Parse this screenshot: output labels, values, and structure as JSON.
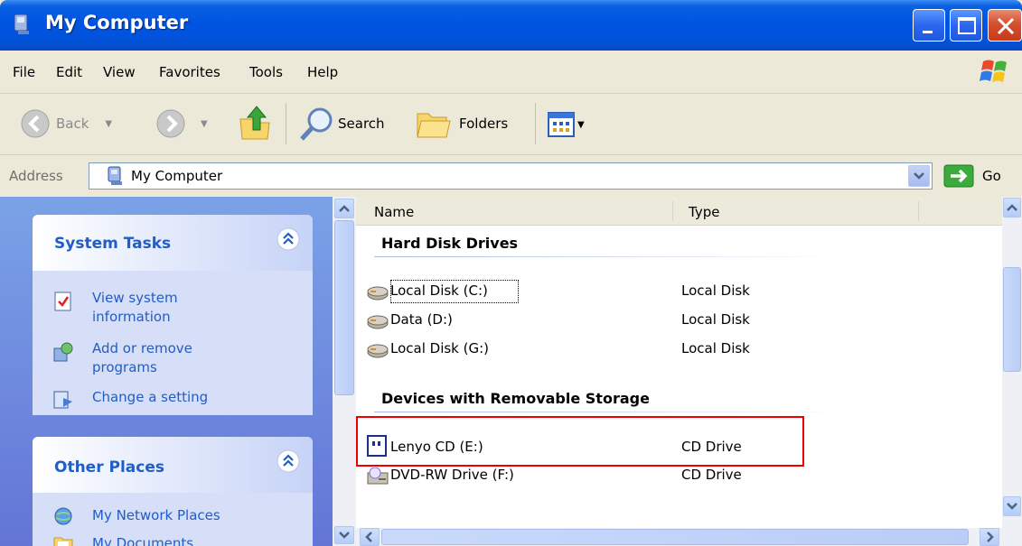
{
  "window": {
    "title": "My Computer"
  },
  "menu": [
    "File",
    "Edit",
    "View",
    "Favorites",
    "Tools",
    "Help"
  ],
  "toolbar": {
    "back_label": "Back",
    "search_label": "Search",
    "folders_label": "Folders"
  },
  "address": {
    "label": "Address",
    "value": "My Computer",
    "go_label": "Go"
  },
  "left_pane": {
    "system_tasks": {
      "title": "System Tasks",
      "items": [
        "View system information",
        "Add or remove programs",
        "Change a setting"
      ]
    },
    "other_places": {
      "title": "Other Places",
      "items": [
        "My Network Places",
        "My Documents"
      ]
    }
  },
  "list": {
    "columns": [
      "Name",
      "Type"
    ],
    "groups": [
      {
        "title": "Hard Disk Drives",
        "items": [
          {
            "name": "Local Disk (C:)",
            "type": "Local Disk",
            "icon": "hard-disk-icon"
          },
          {
            "name": "Data (D:)",
            "type": "Local Disk",
            "icon": "hard-disk-icon"
          },
          {
            "name": "Local Disk (G:)",
            "type": "Local Disk",
            "icon": "hard-disk-icon"
          }
        ]
      },
      {
        "title": "Devices with Removable Storage",
        "items": [
          {
            "name": "Lenyo CD (E:)",
            "type": "CD Drive",
            "icon": "lenyo-cd-icon"
          },
          {
            "name": "DVD-RW Drive (F:)",
            "type": "CD Drive",
            "icon": "dvd-drive-icon"
          }
        ]
      }
    ]
  },
  "colors": {
    "title_bar": "#0054e3",
    "task_link": "#215dc6",
    "highlight": "#ee0000"
  }
}
